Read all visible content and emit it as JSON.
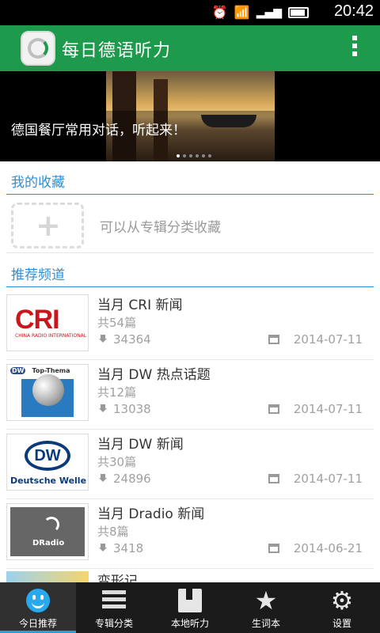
{
  "status_bar": {
    "time": "20:42"
  },
  "app_bar": {
    "title": "每日德语听力"
  },
  "banner": {
    "caption": "德国餐厅常用对话，听起来！",
    "dots": 6,
    "active_dot": 0
  },
  "favorites": {
    "header": "我的收藏",
    "hint": "可以从专辑分类收藏",
    "add_symbol": "+"
  },
  "recommended": {
    "header": "推荐频道",
    "channels": [
      {
        "title": "当月 CRI 新闻",
        "count": "共54篇",
        "downloads": "34364",
        "date": "2014-07-11",
        "thumb": "cri"
      },
      {
        "title": "当月 DW 热点话题",
        "count": "共12篇",
        "downloads": "13038",
        "date": "2014-07-11",
        "thumb": "dw-top"
      },
      {
        "title": "当月 DW 新闻",
        "count": "共30篇",
        "downloads": "24896",
        "date": "2014-07-11",
        "thumb": "dw"
      },
      {
        "title": "当月 Dradio 新闻",
        "count": "共8篇",
        "downloads": "3418",
        "date": "2014-06-21",
        "thumb": "dradio"
      },
      {
        "title": "变形记",
        "thumb": "partial"
      }
    ]
  },
  "thumbs": {
    "cri_text": "CRI",
    "cri_sub": "CHINA RADIO INTERNATIONAL",
    "dw_top_badge": "DW",
    "dw_top_text": "Top-Thema",
    "dw_text": "DW",
    "dw_name": "Deutsche Welle",
    "dradio_text": "DRadio"
  },
  "bottom_nav": [
    {
      "label": "今日推荐",
      "icon": "smile-icon",
      "active": true
    },
    {
      "label": "专辑分类",
      "icon": "list-icon",
      "active": false
    },
    {
      "label": "本地听力",
      "icon": "book-icon",
      "active": false
    },
    {
      "label": "生词本",
      "icon": "star-icon",
      "active": false
    },
    {
      "label": "设置",
      "icon": "gear-icon",
      "active": false
    }
  ]
}
